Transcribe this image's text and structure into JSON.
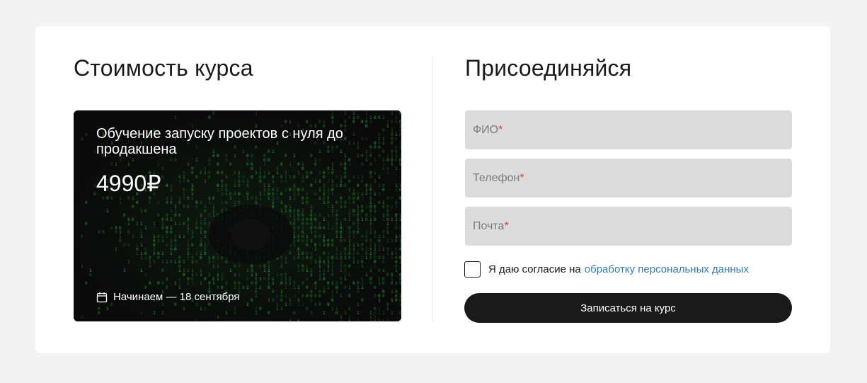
{
  "left": {
    "title": "Стоимость курса",
    "card": {
      "title": "Обучение запуску проектов с нуля до продакшена",
      "price": "4990₽",
      "start_date": "Начинаем — 18 сентября",
      "icon": "calendar-icon"
    }
  },
  "right": {
    "title": "Присоединяйся",
    "fields": [
      {
        "placeholder": "ФИО",
        "required_mark": "*"
      },
      {
        "placeholder": "Телефон",
        "required_mark": "*"
      },
      {
        "placeholder": "Почта",
        "required_mark": "*"
      }
    ],
    "consent": {
      "text": "Я даю согласие на",
      "link": "обработку персональных данных",
      "checked": false
    },
    "submit_label": "Записаться на курс"
  },
  "colors": {
    "background": "#f3f3f3",
    "panel": "#ffffff",
    "field": "#dcdcdc",
    "button": "#1a1a1a",
    "link": "#2f7bbf",
    "required": "#e53935",
    "matrix_green": "#39c44a"
  }
}
